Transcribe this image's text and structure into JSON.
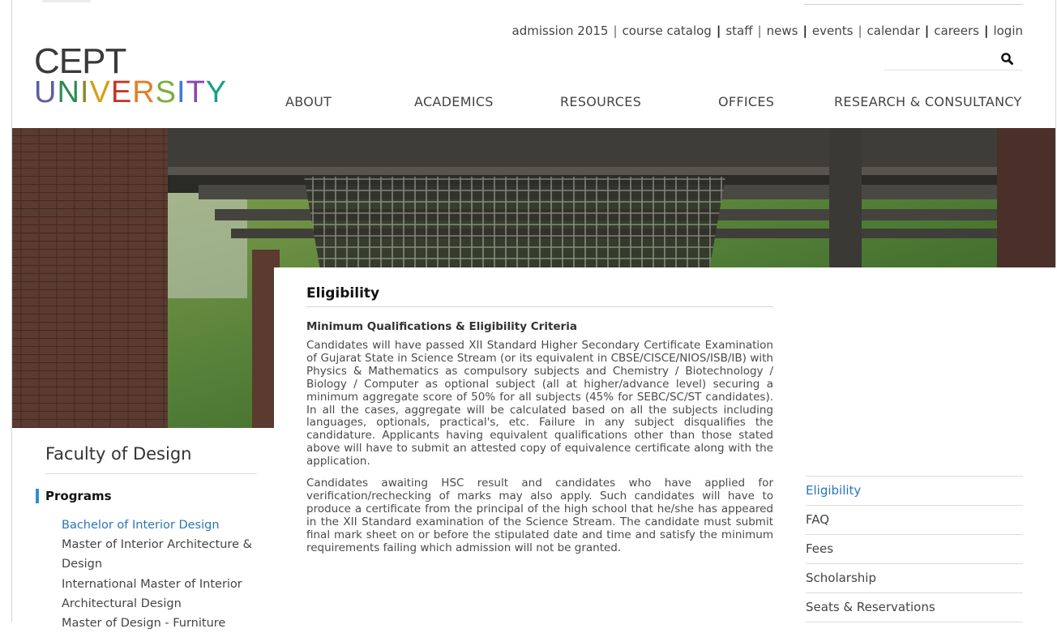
{
  "utility_nav": {
    "items": [
      "admission 2015",
      "course catalog",
      "staff",
      "news",
      "events",
      "calendar",
      "careers",
      "login"
    ],
    "separators": [
      "|",
      "|",
      "|",
      "|",
      "|",
      "|",
      "|"
    ]
  },
  "search": {
    "icon": "search-icon"
  },
  "logo": {
    "line1": "CEPT",
    "line2": [
      "U",
      "N",
      "I",
      "V",
      "E",
      "R",
      "S",
      "I",
      "T",
      "Y"
    ]
  },
  "main_nav": {
    "items": [
      "ABOUT",
      "ACADEMICS",
      "RESOURCES",
      "OFFICES",
      "RESEARCH & CONSULTANCY"
    ]
  },
  "content": {
    "title": "Eligibility",
    "subtitle": "Minimum Qualifications & Eligibility Criteria",
    "paragraph1": "Candidates will have passed XII Standard Higher Secondary Certificate Examination of Gujarat State in Science Stream (or its equivalent in CBSE/CISCE/NIOS/ISB/IB) with Physics & Mathematics as compulsory subjects and Chemistry / Biotechnology / Biology / Computer as optional subject (all at higher/advance level) securing a minimum aggregate score of 50% for all subjects (45% for SEBC/SC/ST candidates). In all the cases, aggregate will be calculated based on all the subjects including languages, optionals, practical's, etc. Failure in any subject disqualifies the candidature. Applicants having equivalent qualifications other than those stated above will have to submit an attested copy of equivalence certificate along with the application.",
    "paragraph2": "Candidates awaiting HSC result and candidates who have applied for verification/rechecking of marks may also apply. Such candidates will have to produce a certificate from the principal of the high school that he/she has appeared in the XII Standard examination of the Science Stream. The candidate must submit final mark sheet on or before the stipulated date and time and satisfy the minimum requirements failing which admission will not be granted."
  },
  "faculty": {
    "title": "Faculty of Design",
    "section_label": "Programs",
    "programs": [
      "Bachelor of Interior Design",
      "Master of Interior Architecture & Design",
      "International Master of Interior Architectural Design",
      "Master of Design - Furniture"
    ]
  },
  "side_menu": {
    "items": [
      "Eligibility",
      "FAQ",
      "Fees",
      "Scholarship",
      "Seats & Reservations"
    ]
  },
  "colors": {
    "accent_blue": "#2a75b8",
    "logo_letters": [
      "#5b5ea6",
      "#2e8b57",
      "#8a8a2a",
      "#d4a017",
      "#c0392b",
      "#e67e22",
      "#7cae3a",
      "#3b7dd8",
      "#8e44ad",
      "#16a085"
    ]
  }
}
